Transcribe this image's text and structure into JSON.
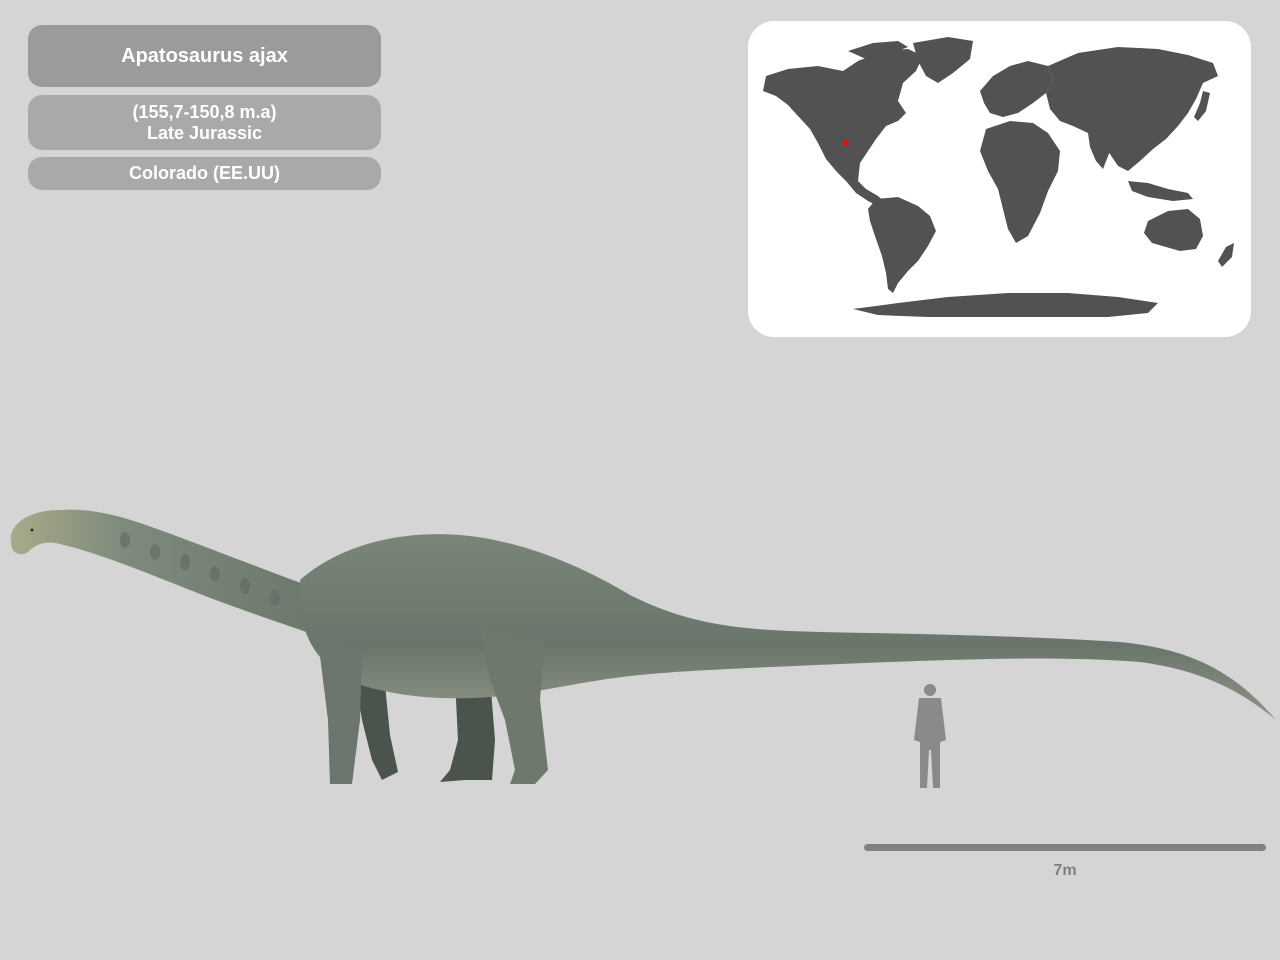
{
  "species": {
    "name": "Apatosaurus ajax",
    "age_range": "(155,7-150,8 m.a)",
    "period": "Late Jurassic",
    "location": "Colorado (EE.UU)"
  },
  "map": {
    "land_color": "#525252",
    "background_color": "#ffffff",
    "marker_color": "#e01010"
  },
  "scale": {
    "label": "7m",
    "bar_color": "#808080"
  },
  "colors": {
    "page_background": "#d5d5d5",
    "label_background": "#9b9b9b",
    "dinosaur_body": "#6f7a70",
    "human_silhouette": "#8a8a8a"
  }
}
